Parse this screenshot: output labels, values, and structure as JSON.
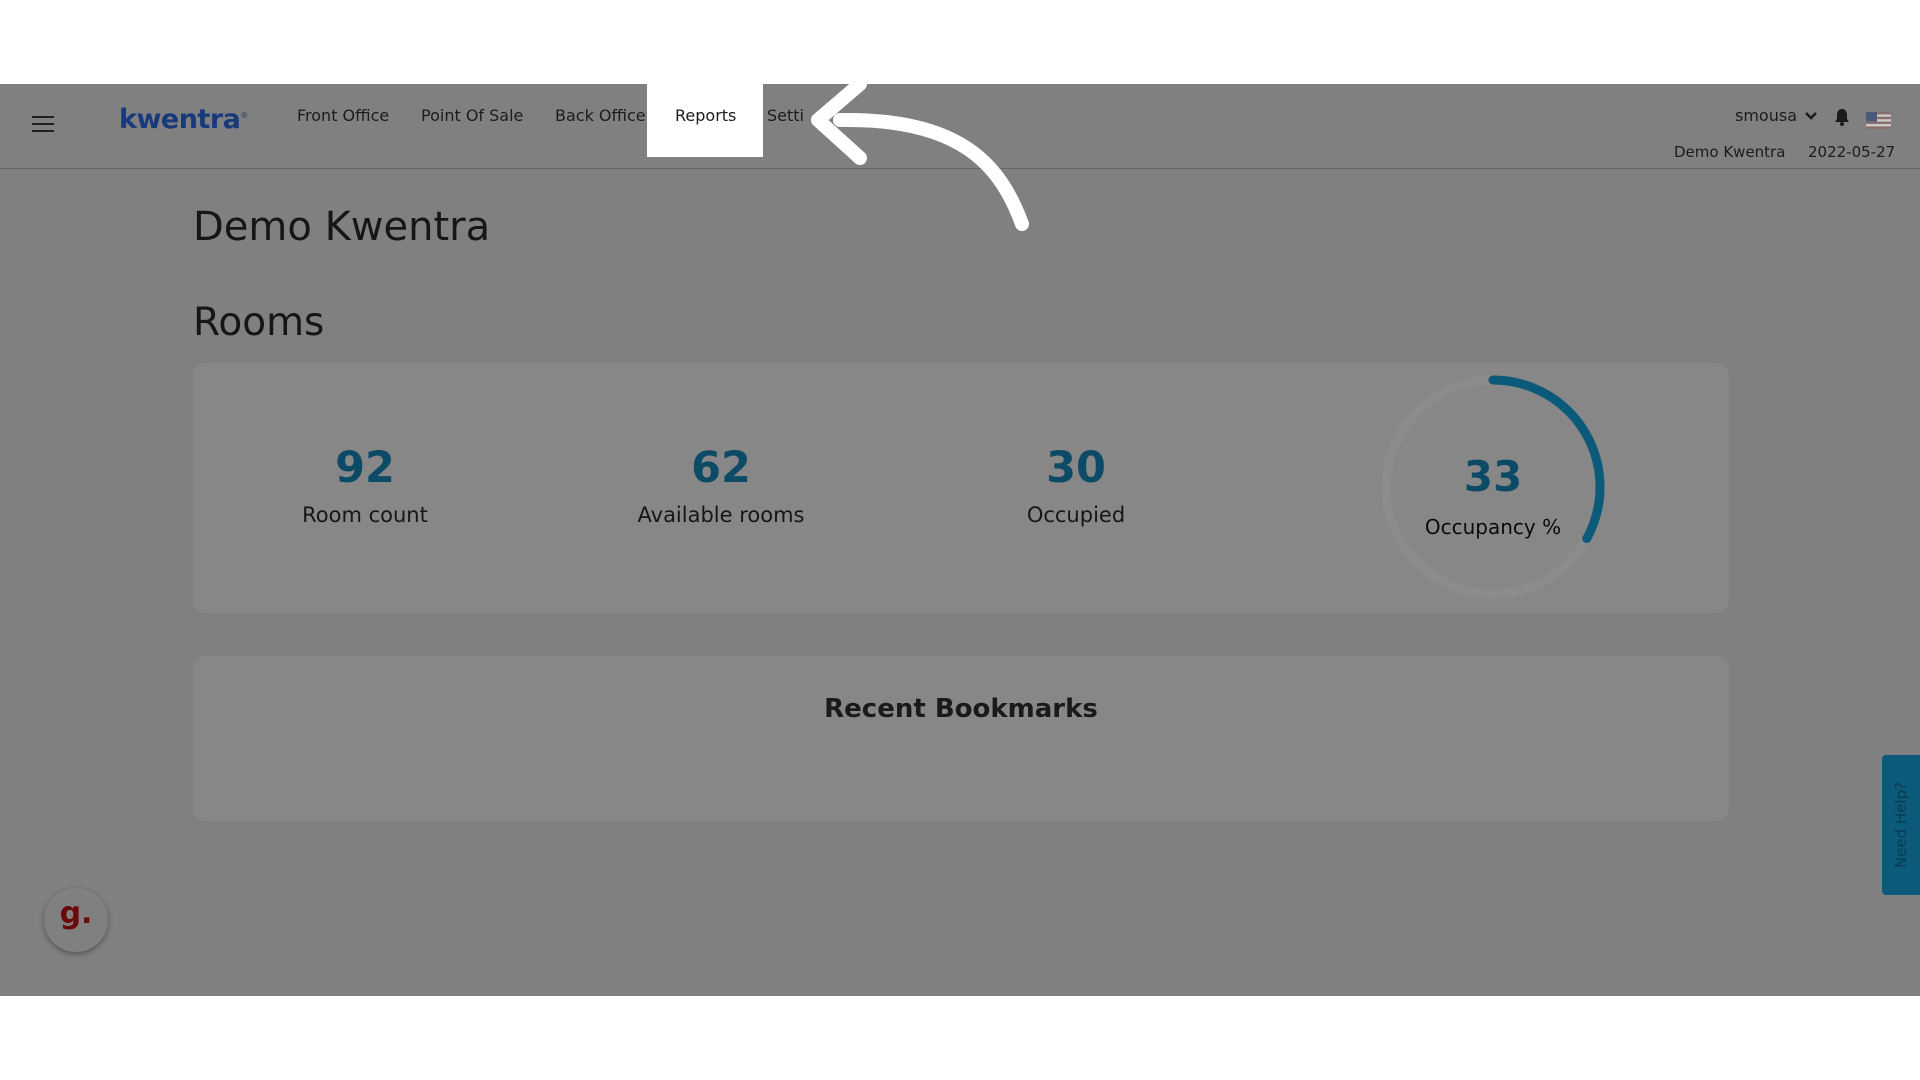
{
  "app": {
    "logo": "kwentra",
    "logo_mark": "®"
  },
  "nav": {
    "items": [
      "Front Office",
      "Point Of Sale",
      "Back Office"
    ],
    "active": "Reports",
    "partial": "Setti"
  },
  "user": {
    "name": "smousa",
    "property": "Demo Kwentra",
    "date": "2022-05-27"
  },
  "page": {
    "title": "Demo Kwentra",
    "section": "Rooms"
  },
  "stats": [
    {
      "value": "92",
      "label": "Room count"
    },
    {
      "value": "62",
      "label": "Available rooms"
    },
    {
      "value": "30",
      "label": "Occupied"
    }
  ],
  "occupancy": {
    "value": "33",
    "label": "Occupancy %",
    "fraction": 0.33
  },
  "bookmarks": {
    "title": "Recent Bookmarks"
  },
  "help": {
    "label": "Need Help?"
  },
  "widget": {
    "label": "g."
  },
  "colors": {
    "accent": "#0c5a7a",
    "brand": "#173a7a",
    "overlay": "#808080",
    "ring_track": "#8c8c8c"
  }
}
